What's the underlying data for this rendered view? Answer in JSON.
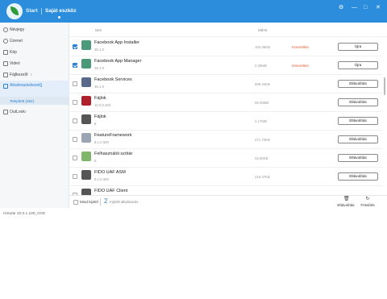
{
  "header": {
    "tabs": [
      {
        "label": "Start"
      },
      {
        "label": "Saját eszköz"
      }
    ],
    "controls": [
      "⚙",
      "—",
      "□",
      "✕"
    ]
  },
  "sidebar": {
    "items": [
      {
        "label": "Névjegy",
        "icon": "contacts-icon"
      },
      {
        "label": "Üzenet",
        "icon": "message-icon"
      },
      {
        "label": "Kép",
        "icon": "image-icon"
      },
      {
        "label": "Videó",
        "icon": "video-icon"
      },
      {
        "label": "Fájlkezelő",
        "icon": "folder-icon"
      },
      {
        "label": "Alkalmazáskezelő",
        "icon": "apps-icon"
      },
      {
        "label": "OutLook",
        "icon": "outlook-icon"
      }
    ],
    "sub_item": "Telepített (252)"
  },
  "table": {
    "col_name": "Név",
    "col_size": "Méret",
    "rows": [
      {
        "name": "Facebook App Installer",
        "version": "35.1.9",
        "size": "104.45KB",
        "status": "Ismeretlen",
        "action": "Újra",
        "checked": true,
        "icon_color": "#4a9a7a"
      },
      {
        "name": "Facebook App Manager",
        "version": "35.1.9",
        "size": "2.29MB",
        "status": "Ismeretlen",
        "action": "Újra",
        "checked": true,
        "icon_color": "#4a9a7a"
      },
      {
        "name": "Facebook Services",
        "version": "35.1.9",
        "size": "668.34KB",
        "status": "",
        "action": "Eltávolítás",
        "checked": false,
        "icon_color": "#5a6a8a"
      },
      {
        "name": "Fájlok",
        "version": "10.0.0.203",
        "size": "58.45MB",
        "status": "",
        "action": "Eltávolítás",
        "checked": false,
        "icon_color": "#b0202a"
      },
      {
        "name": "Fájlok",
        "version": "8",
        "size": "4.17MB",
        "status": "",
        "action": "Eltávolítás",
        "checked": false,
        "icon_color": "#555555"
      },
      {
        "name": "FeatureFramework",
        "version": "9.1.0.300",
        "size": "271.70KB",
        "status": "",
        "action": "Eltávolítás",
        "checked": false,
        "icon_color": "#9aa4b2"
      },
      {
        "name": "Felhasználói szótár",
        "version": "8",
        "size": "33.80KB",
        "status": "",
        "action": "Eltávolítás",
        "checked": false,
        "icon_color": "#7fb66a"
      },
      {
        "name": "FIDO UAF ASM",
        "version": "9.1.0.300",
        "size": "415.37KB",
        "status": "",
        "action": "Eltávolítás",
        "checked": false,
        "icon_color": "#555555"
      },
      {
        "name": "FIDO UAF Client",
        "version": "",
        "size": "",
        "status": "",
        "action": "",
        "checked": false,
        "icon_color": "#555555"
      }
    ]
  },
  "footer": {
    "select_all": "Mind kijelöl",
    "count": "2",
    "count_label": "Kijelölt alkalmazás",
    "uninstall": "Eltávolítás",
    "reinstall": "Frissítés"
  },
  "statusbar": "HiSuite 10.0.1.100_OVE"
}
